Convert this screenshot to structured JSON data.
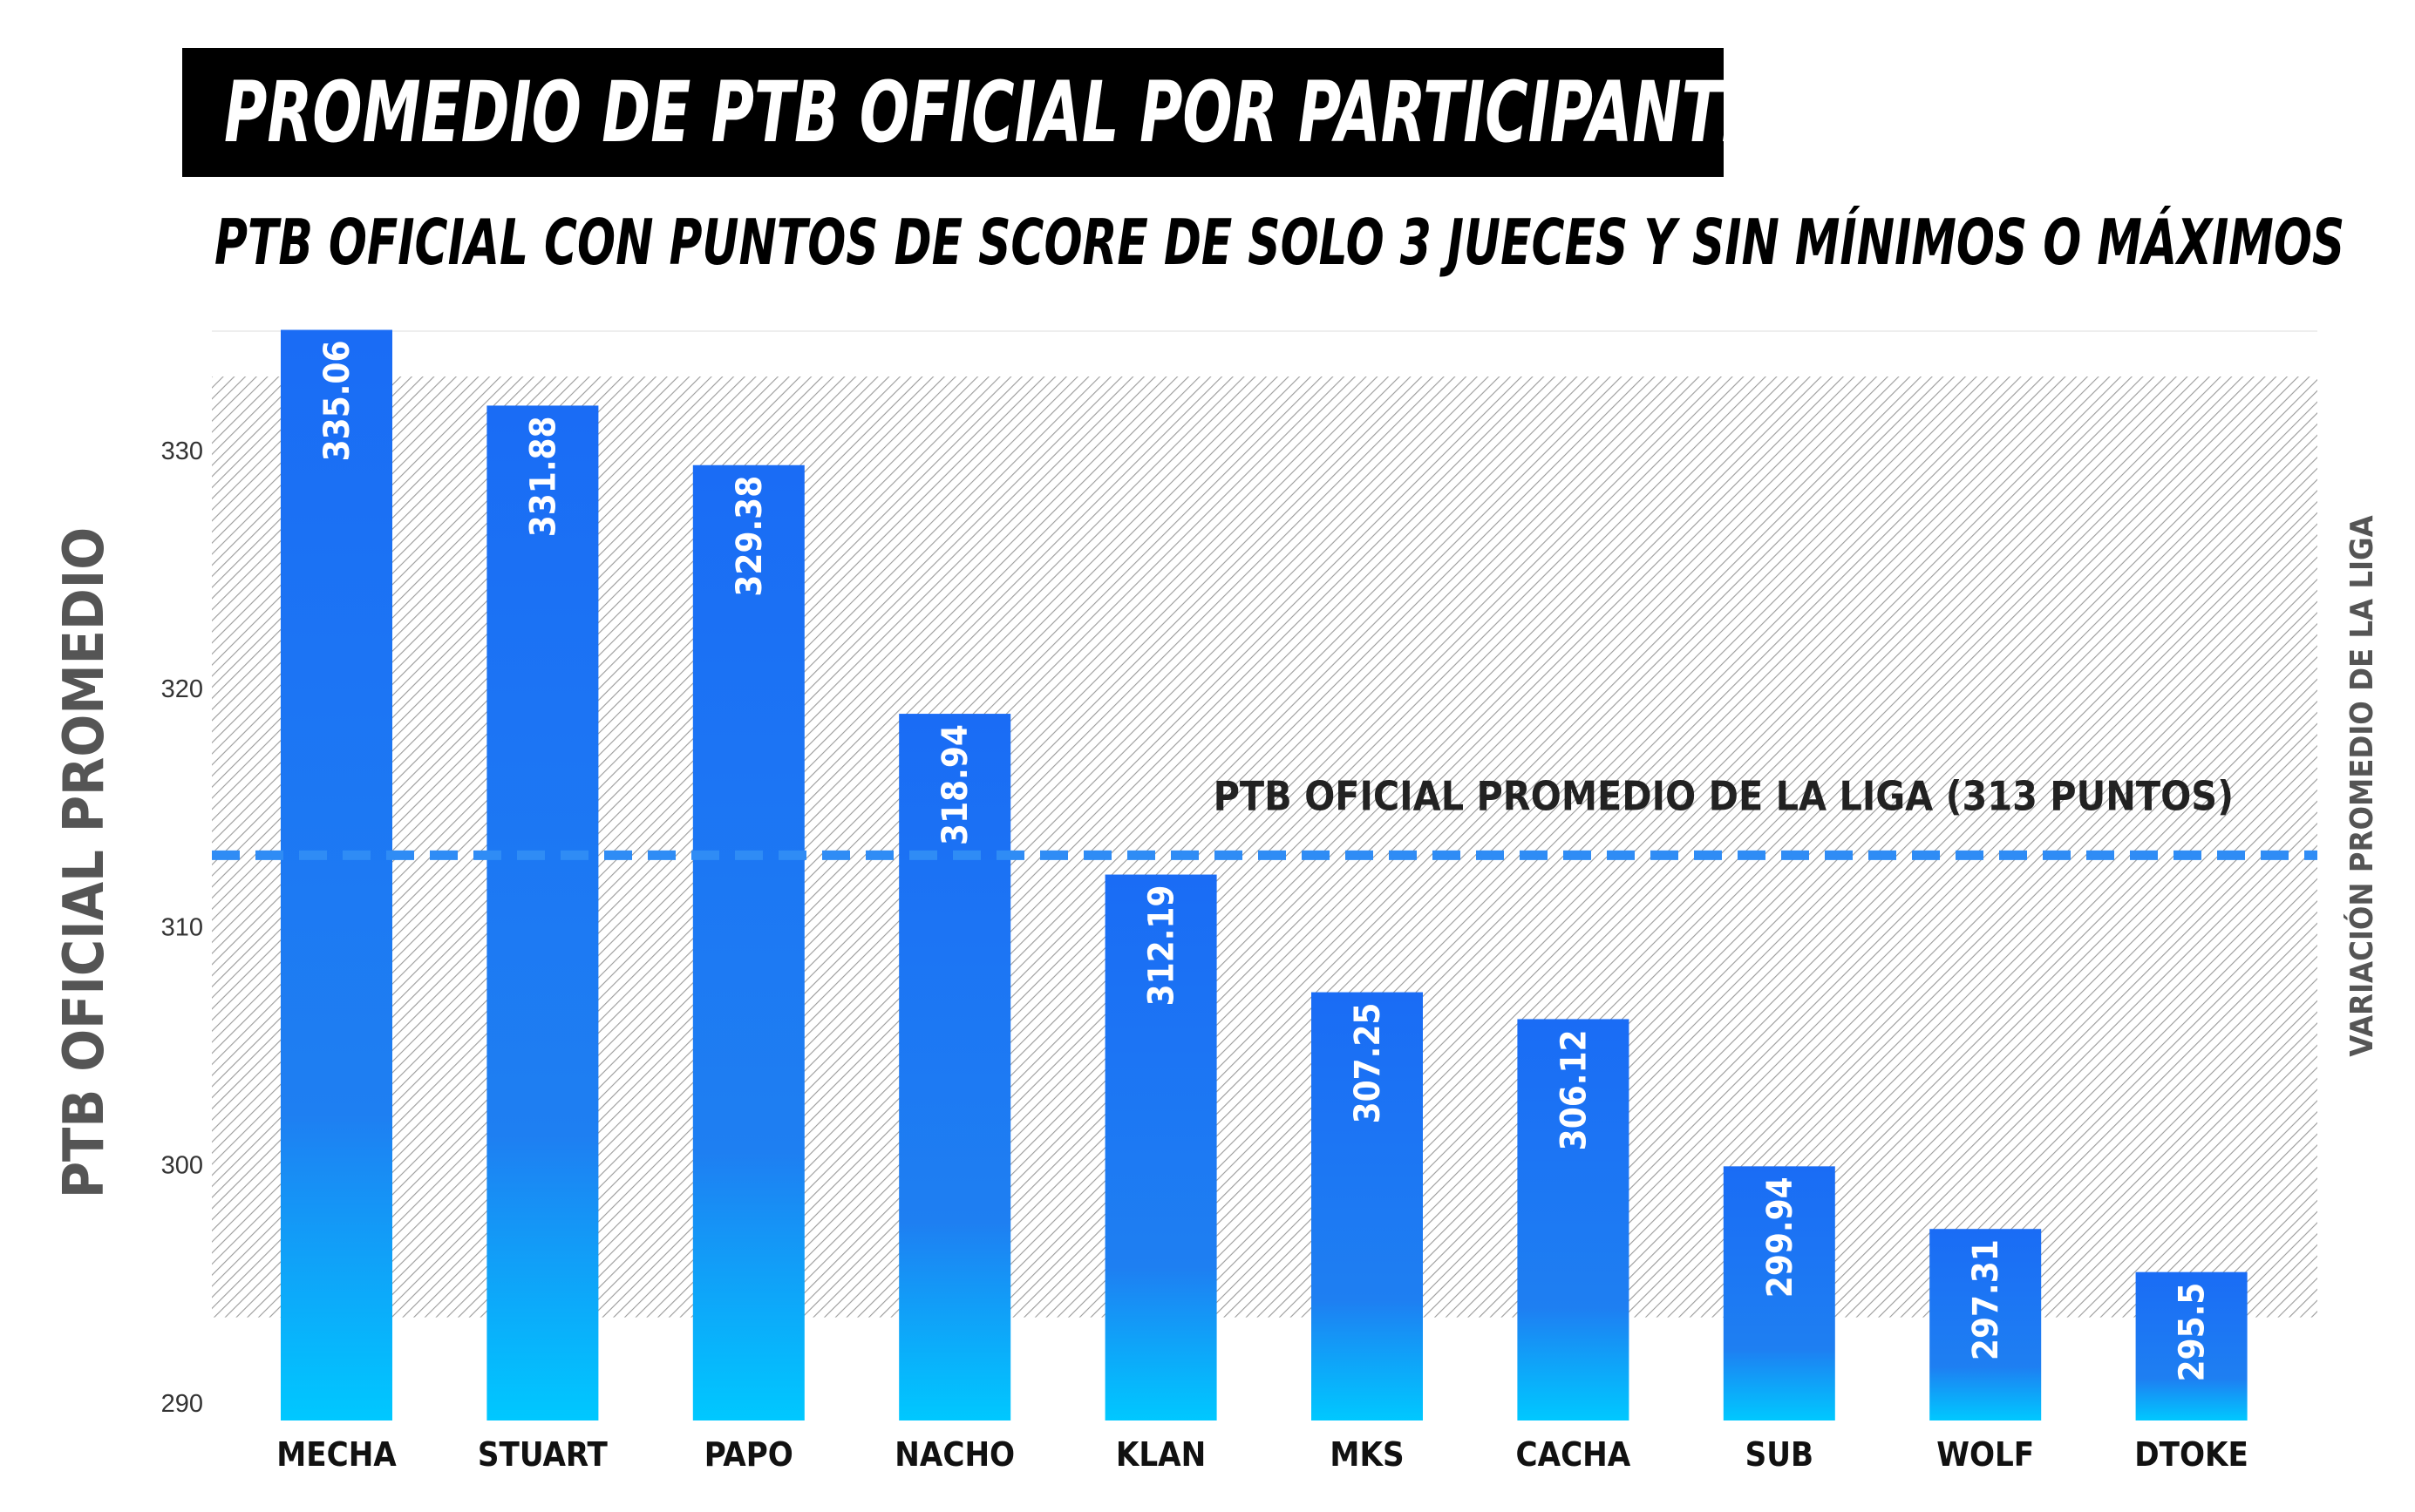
{
  "title": "PROMEDIO DE PTB OFICIAL POR PARTICIPANTE",
  "subtitle": "PTB OFICIAL CON PUNTOS DE SCORE DE SOLO 3 JUECES Y SIN MÍNIMOS O MÁXIMOS",
  "colors": {
    "bar_top": "#1a6cf5",
    "bar_mid": "#1e7ff2",
    "bar_bottom": "#00c8ff",
    "average_line": "#2f8cf5",
    "band_hatch": "#9a9a9a",
    "text_dark": "#222222",
    "tick_text": "#333333"
  },
  "chart_data": {
    "type": "bar",
    "title": "",
    "xlabel": "",
    "ylabel": "PTB OFICIAL PROMEDIO",
    "right_label": "VARIACIÓN PROMEDIO DE LA LIGA",
    "categories": [
      "MECHA",
      "STUART",
      "PAPO",
      "NACHO",
      "KLAN",
      "MKS",
      "CACHA",
      "SUB",
      "WOLF",
      "DTOKE"
    ],
    "values": [
      335.06,
      331.88,
      329.38,
      318.94,
      312.19,
      307.25,
      306.12,
      299.94,
      297.31,
      295.5
    ],
    "data_labels": [
      "335.06",
      "331.88",
      "329.38",
      "318.94",
      "312.19",
      "307.25",
      "306.12",
      "299.94",
      "297.31",
      "295.5"
    ],
    "ylim": [
      290,
      335
    ],
    "yticks": [
      290,
      300,
      310,
      320,
      330
    ],
    "grid": false,
    "reference_line": {
      "value": 313,
      "label": "PTB OFICIAL PROMEDIO DE LA LIGA (313 PUNTOS)",
      "style": "dashed"
    },
    "shaded_band": {
      "from": 293.6,
      "to": 333.1,
      "style": "hatched"
    }
  }
}
